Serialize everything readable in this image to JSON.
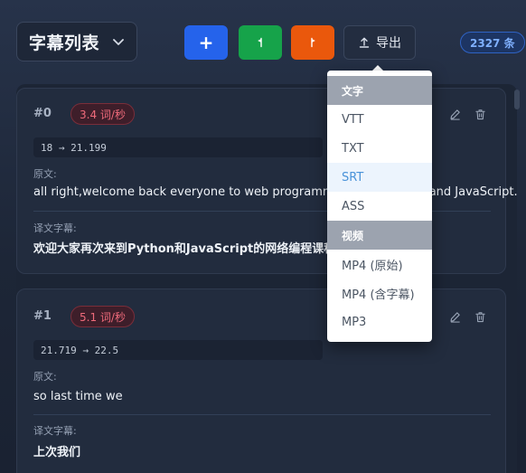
{
  "header": {
    "list_title": "字幕列表",
    "add_button_label": "+",
    "export_label": "导出",
    "count_badge": "2327 条"
  },
  "export_menu": {
    "groups": [
      {
        "label": "文字",
        "items": [
          "VTT",
          "TXT",
          "SRT",
          "ASS"
        ]
      },
      {
        "label": "视频",
        "items": [
          "MP4 (原始)",
          "MP4 (含字幕)",
          "MP3"
        ]
      }
    ],
    "active_item": "SRT"
  },
  "subtitles": [
    {
      "index": "#0",
      "rate": "3.4 词/秒",
      "timecode": "18 → 21.199",
      "source_label": "原文:",
      "source_text": "all right,welcome back everyone to web programming with Python and JavaScript.",
      "translation_label": "译文字幕:",
      "translation_text": "欢迎大家再次来到Python和JavaScript的网络编程课程。"
    },
    {
      "index": "#1",
      "rate": "5.1 词/秒",
      "timecode": "21.719 → 22.5",
      "source_label": "原文:",
      "source_text": "so last time we",
      "translation_label": "译文字幕:",
      "translation_text": "上次我们"
    }
  ],
  "colors": {
    "add_button": "#2563eb",
    "green_button": "#16a34a",
    "orange_button": "#ea580c",
    "count_badge_text": "#7fb0ff",
    "rate_badge_text": "#f06b7b",
    "active_menu_text": "#4a93d9"
  },
  "icons": {
    "list_dropdown": "chevron-down-icon",
    "green_button": "flag-left-icon",
    "orange_button": "flag-right-icon",
    "export": "upload-icon",
    "edit": "pencil-icon",
    "delete": "trash-icon"
  }
}
